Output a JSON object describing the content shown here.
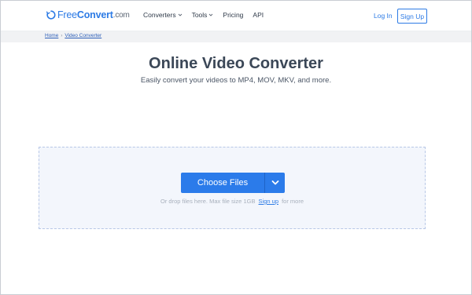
{
  "header": {
    "logo": {
      "part1": "Free",
      "part2": "Convert",
      "part3": ".com"
    },
    "nav": [
      {
        "label": "Converters",
        "has_dropdown": true
      },
      {
        "label": "Tools",
        "has_dropdown": true
      },
      {
        "label": "Pricing",
        "has_dropdown": false
      },
      {
        "label": "API",
        "has_dropdown": false
      }
    ],
    "login_label": "Log In",
    "signup_label": "Sign Up"
  },
  "breadcrumb": {
    "home": "Home",
    "current": "Video Converter"
  },
  "hero": {
    "title": "Online Video Converter",
    "subtitle": "Easily convert your videos to MP4, MOV, MKV, and more."
  },
  "dropzone": {
    "choose_label": "Choose Files",
    "hint_prefix": "Or drop files here. Max file size 1GB",
    "hint_link": "Sign up",
    "hint_suffix": "for more"
  },
  "colors": {
    "accent": "#2b7bea",
    "title": "#3b4757",
    "dropzone_bg": "#f3f6fc"
  },
  "icons": {
    "logo": "refresh-circle-icon",
    "nav_dropdown": "chevron-down-icon",
    "choose_dropdown": "chevron-down-icon"
  }
}
